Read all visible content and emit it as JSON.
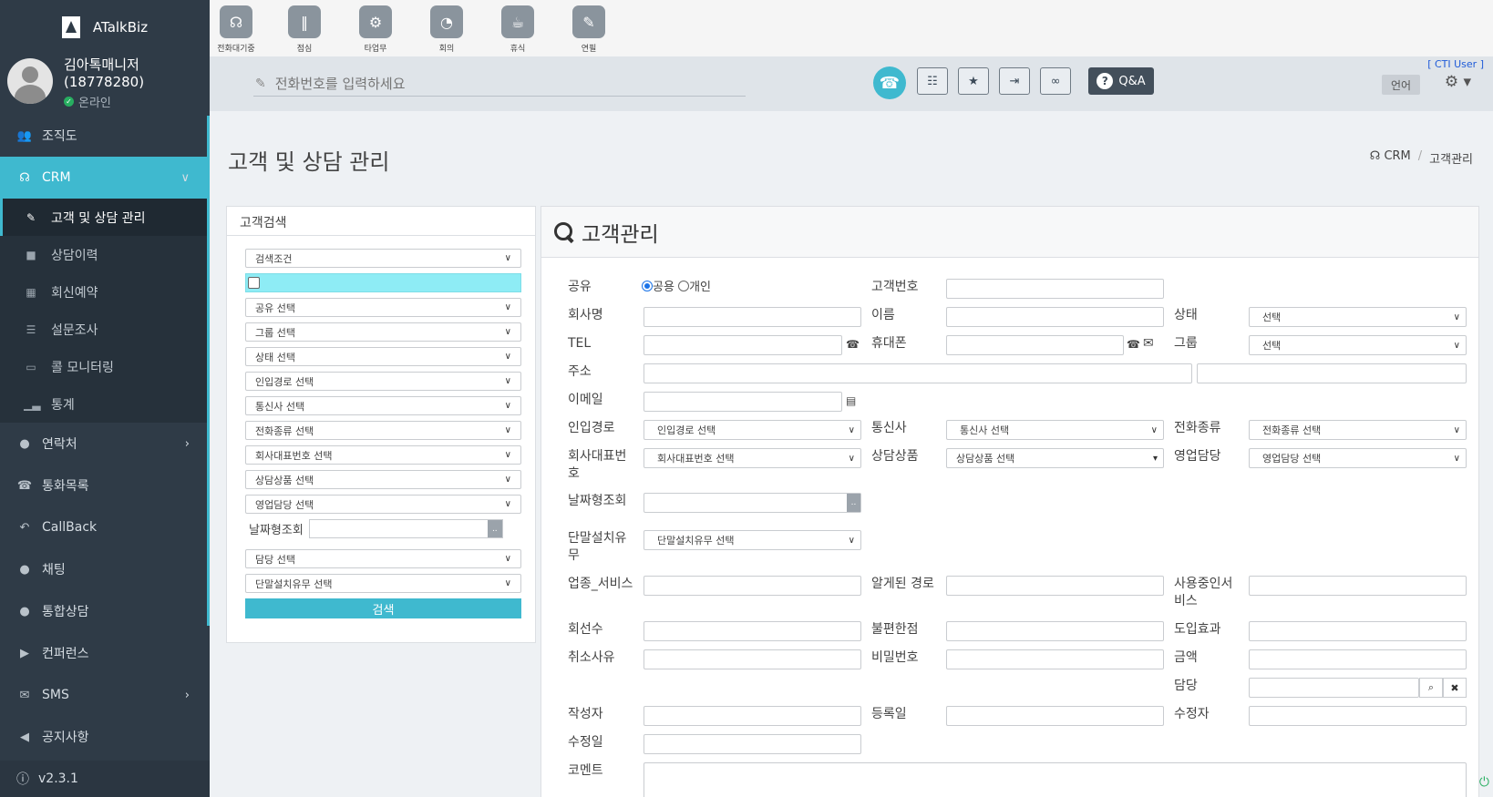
{
  "brand": {
    "name": "ATalkBiz"
  },
  "user": {
    "name": "김아톡매니저",
    "id": "(18778280)",
    "status": "온라인"
  },
  "sidebar": {
    "items": [
      {
        "label": "조직도",
        "icon": "users-icon"
      },
      {
        "label": "CRM",
        "icon": "headset-icon"
      },
      {
        "label": "연락처",
        "icon": "user-icon"
      },
      {
        "label": "통화목록",
        "icon": "phone-book-icon"
      },
      {
        "label": "CallBack",
        "icon": "reply-icon"
      },
      {
        "label": "채팅",
        "icon": "chat-icon"
      },
      {
        "label": "통합상담",
        "icon": "chat-icon"
      },
      {
        "label": "컨퍼런스",
        "icon": "video-icon"
      },
      {
        "label": "SMS",
        "icon": "envelope-icon"
      },
      {
        "label": "공지사항",
        "icon": "megaphone-icon"
      }
    ],
    "crm_sub": [
      "고객 및 상담 관리",
      "상담이력",
      "회신예약",
      "설문조사",
      "콜 모니터링",
      "통계"
    ],
    "version": "v2.3.1"
  },
  "toolbar": {
    "buttons": [
      "전화대기중",
      "점심",
      "타업무",
      "회의",
      "휴식",
      "연필"
    ]
  },
  "phonebar": {
    "dial_placeholder": "전화번호를 입력하세요",
    "qa": "Q&A",
    "cti_user": "[ CTI User ]",
    "lang": "언어"
  },
  "page": {
    "title": "고객 및 상담 관리",
    "crumb1": "CRM",
    "crumb2": "고객관리"
  },
  "search_panel": {
    "title": "고객검색",
    "condition": "검색조건",
    "selects": [
      "공유 선택",
      "그룹 선택",
      "상태 선택",
      "인입경로 선택",
      "통신사 선택",
      "전화종류 선택",
      "회사대표번호 선택",
      "상담상품 선택",
      "영업담당 선택"
    ],
    "date_label": "날짜형조회",
    "date_btn": "..",
    "assign": "담당 선택",
    "terminal": "단말설치유무 선택",
    "search_btn": "검색"
  },
  "customer_panel": {
    "title": "고객관리",
    "labels": {
      "share": "공유",
      "share_public": "공용",
      "share_private": "개인",
      "cust_no": "고객번호",
      "company": "회사명",
      "name": "이름",
      "state": "상태",
      "tel": "TEL",
      "mobile": "휴대폰",
      "group": "그룹",
      "address": "주소",
      "email": "이메일",
      "inflow": "인입경로",
      "carrier": "통신사",
      "phone_type": "전화종류",
      "rep_no_1": "회사대표번",
      "rep_no_2": "호",
      "product": "상담상품",
      "sales": "영업담당",
      "date_search": "날짜형조회",
      "terminal_1": "단말설치유",
      "terminal_2": "무",
      "industry": "업종_서비스",
      "known_path": "알게된 경로",
      "service_1": "사용중인서",
      "service_2": "비스",
      "lines": "회선수",
      "complaint": "불편한점",
      "effect": "도입효과",
      "cancel": "취소사유",
      "password": "비밀번호",
      "amount": "금액",
      "assign": "담당",
      "writer": "작성자",
      "reg_date": "등록일",
      "modifier": "수정자",
      "mod_date": "수정일",
      "comment": "코멘트"
    },
    "selects": {
      "state": "선택",
      "group": "선택",
      "inflow": "인입경로 선택",
      "carrier": "통신사 선택",
      "phone_type": "전화종류 선택",
      "rep_no": "회사대표번호 선택",
      "product": "상담상품 선택",
      "sales": "영업담당 선택",
      "terminal": "단말설치유무 선택"
    },
    "date_btn": ".."
  }
}
